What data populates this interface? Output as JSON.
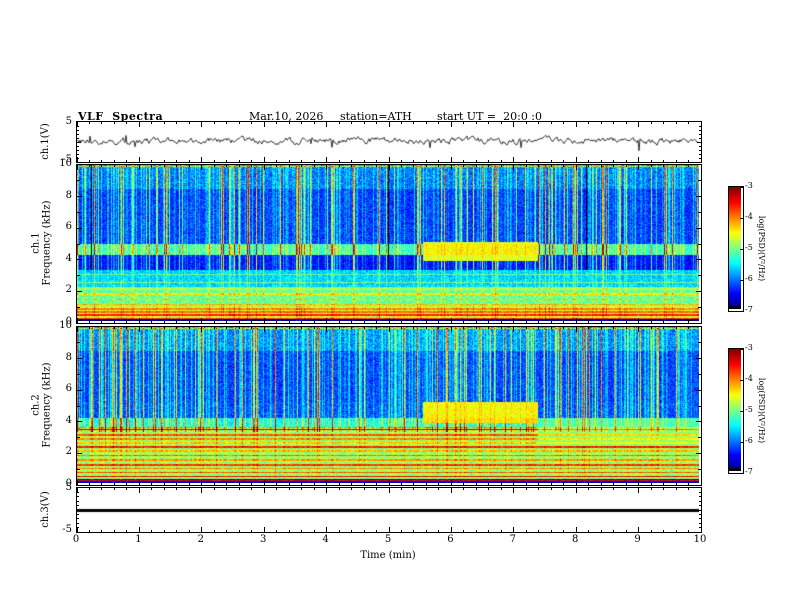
{
  "header": {
    "title": "VLF  Spectra",
    "date": "Mar.10, 2026",
    "station": "station=ATH",
    "start_ut": "start UT =  20:0 :0"
  },
  "xaxis": {
    "label": "Time  (min)",
    "tick_labels": [
      "0",
      "1",
      "2",
      "3",
      "4",
      "5",
      "6",
      "7",
      "8",
      "9",
      "10"
    ],
    "min": 0,
    "max": 10
  },
  "colorbar": {
    "label": "log(PSD)(V²/Hz)",
    "tick_labels": [
      "-3",
      "-4",
      "-5",
      "-6",
      "-7"
    ],
    "min": -7,
    "max": -3
  },
  "panels": {
    "ch1_wave": {
      "ylabel": "ch.1(V)",
      "ytick_labels": [
        "5",
        "-5"
      ],
      "ymin": -5,
      "ymax": 5
    },
    "ch1_spec": {
      "ylabel_channel": "ch.1",
      "ylabel_axis": "Frequency (kHz)",
      "ytick_labels": [
        "10",
        "8",
        "6",
        "4",
        "2",
        "0"
      ],
      "ymin": 0,
      "ymax": 10
    },
    "ch2_spec": {
      "ylabel_channel": "ch.2",
      "ylabel_axis": "Frequency (kHz)",
      "ytick_labels": [
        "10",
        "8",
        "6",
        "4",
        "2",
        "0"
      ],
      "ymin": 0,
      "ymax": 10
    },
    "ch3_wave": {
      "ylabel": "ch.3(V)",
      "ytick_labels": [
        "5",
        "-5"
      ],
      "ymin": -5,
      "ymax": 5
    }
  },
  "chart_data": {
    "type": "heatmap",
    "title": "VLF Spectra — multichannel spectrogram, station ATH, Mar.10 2026, start UT 20:00:00",
    "x": {
      "label": "Time (min)",
      "range": [
        0,
        10
      ]
    },
    "colorbar": {
      "label": "log(PSD)(V²/Hz)",
      "range": [
        -7,
        -3
      ],
      "colormap": "jet",
      "bottom_color": "#000000"
    },
    "panels": [
      {
        "id": "ch1_wave",
        "type": "line",
        "ylabel": "ch.1(V)",
        "y_range": [
          -5,
          5
        ],
        "description": "broadband noise waveform centered on 0 V, typical amplitude ±1 V with impulsive spikes to ±3 V"
      },
      {
        "id": "ch1_spec",
        "type": "spectrogram",
        "ylabel": "ch.1 Frequency (kHz)",
        "y_range": [
          0,
          10
        ],
        "bands": [
          {
            "f": [
              8.5,
              10
            ],
            "level": -6.1,
            "noise": 0.35
          },
          {
            "f": [
              5.0,
              8.5
            ],
            "level": -6.35,
            "noise": 0.3
          },
          {
            "f": [
              4.25,
              5.0
            ],
            "level": -5.35,
            "noise": 0.35
          },
          {
            "f": [
              3.3,
              4.25
            ],
            "level": -6.55,
            "noise": 0.25
          },
          {
            "f": [
              2.2,
              3.3
            ],
            "level": -5.7,
            "noise": 0.3
          },
          {
            "f": [
              1.0,
              2.2
            ],
            "level": -5.15,
            "noise": 0.35
          },
          {
            "f": [
              0.25,
              1.0
            ],
            "level": -4.7,
            "noise": 0.4
          },
          {
            "f": [
              0,
              0.25
            ],
            "level": -6.9,
            "noise": 0.1
          }
        ],
        "lines": [
          [
            9.95,
            -5.0
          ],
          [
            0.18,
            -3.8
          ],
          [
            0.4,
            -3.7
          ],
          [
            0.6,
            -4.0
          ],
          [
            0.8,
            -4.1
          ],
          [
            1.1,
            -4.3
          ],
          [
            1.4,
            -4.4
          ],
          [
            1.75,
            -4.5
          ],
          [
            2.1,
            -4.9
          ],
          [
            2.5,
            -5.1
          ],
          [
            3.0,
            -5.2
          ]
        ],
        "events": [
          {
            "t": [
              5.55,
              7.4
            ],
            "f": [
              3.85,
              5.1
            ],
            "level": -4.35,
            "blend": 0.85
          }
        ],
        "streaks": "dense vertical impulsive sferic streaks above 3.3 kHz, occasional full-column dropouts to -7"
      },
      {
        "id": "ch2_spec",
        "type": "spectrogram",
        "ylabel": "ch.2 Frequency (kHz)",
        "y_range": [
          0,
          10
        ],
        "bands": [
          {
            "f": [
              8.5,
              10
            ],
            "level": -6.0,
            "noise": 0.35
          },
          {
            "f": [
              5.2,
              8.5
            ],
            "level": -6.3,
            "noise": 0.3
          },
          {
            "f": [
              4.2,
              5.2
            ],
            "level": -6.25,
            "noise": 0.3
          },
          {
            "f": [
              3.55,
              4.2
            ],
            "level": -5.5,
            "noise": 0.3
          },
          {
            "f": [
              0.3,
              3.55
            ],
            "level": -4.95,
            "noise": 0.35
          },
          {
            "f": [
              0,
              0.3
            ],
            "level": -6.8,
            "noise": 0.15
          }
        ],
        "lines": [
          [
            9.95,
            -5.0
          ],
          [
            0.18,
            -3.6
          ],
          [
            0.45,
            -3.5
          ],
          [
            0.7,
            -3.9
          ],
          [
            0.95,
            -4.1
          ],
          [
            1.2,
            -3.8
          ],
          [
            1.5,
            -4.2
          ],
          [
            1.8,
            -4.0
          ],
          [
            2.1,
            -4.3
          ],
          [
            2.35,
            -3.7
          ],
          [
            2.6,
            -4.4
          ],
          [
            2.85,
            -4.1
          ],
          [
            3.1,
            -3.9
          ],
          [
            3.45,
            -3.4
          ],
          [
            3.6,
            -4.3
          ]
        ],
        "events": [
          {
            "t": [
              5.55,
              7.4
            ],
            "f": [
              3.85,
              5.2
            ],
            "level": -4.25,
            "blend": 0.85
          },
          {
            "t": [
              7.4,
              10
            ],
            "f": [
              2.4,
              4.2
            ],
            "level": -5.0,
            "blend": 0.45
          }
        ],
        "streaks": "dense vertical impulsive sferic streaks above 3.5 kHz; broad green band with bright horizontal carrier lines below 3.6 kHz"
      },
      {
        "id": "ch3_wave",
        "type": "line",
        "ylabel": "ch.3(V)",
        "y_range": [
          -5,
          5
        ],
        "value": 0,
        "description": "constant flat thick line near 0 V (channel inactive)"
      }
    ]
  }
}
